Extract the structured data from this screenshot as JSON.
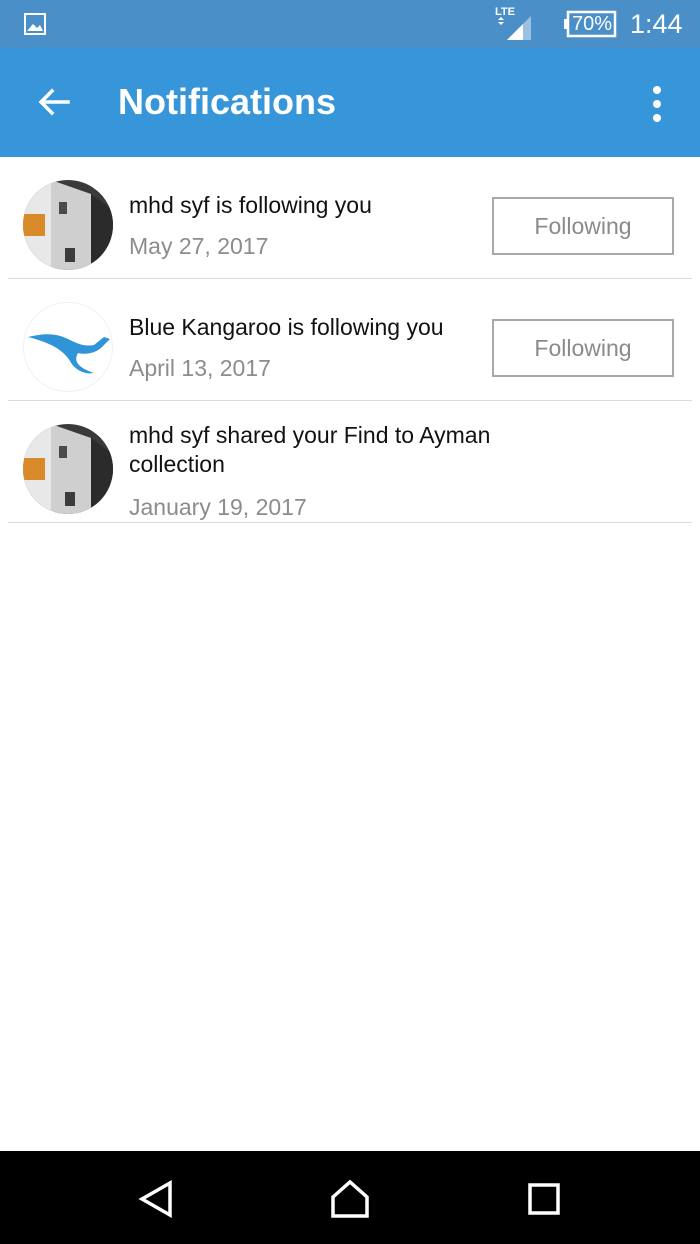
{
  "status_bar": {
    "network_label": "LTE",
    "battery": "70%",
    "time": "1:44",
    "icons": [
      "gallery-notification-icon",
      "lte-signal-icon",
      "battery-icon"
    ]
  },
  "app_bar": {
    "title": "Notifications",
    "back_icon": "arrow-left-icon",
    "menu_icon": "more-vertical-icon",
    "color": "#3796da"
  },
  "notifications": [
    {
      "avatar": "user-photo",
      "text": "mhd syf is following you",
      "date": "May 27, 2017",
      "button_label": "Following"
    },
    {
      "avatar": "blue-kangaroo-logo",
      "text": "Blue Kangaroo is following you",
      "date": "April 13, 2017",
      "button_label": "Following"
    },
    {
      "avatar": "user-photo",
      "text": "mhd syf shared your Find to Ayman collection",
      "date": "January 19, 2017"
    }
  ],
  "nav_bar": {
    "back_icon": "nav-back-triangle-icon",
    "home_icon": "nav-home-icon",
    "recents_icon": "nav-recents-square-icon"
  }
}
